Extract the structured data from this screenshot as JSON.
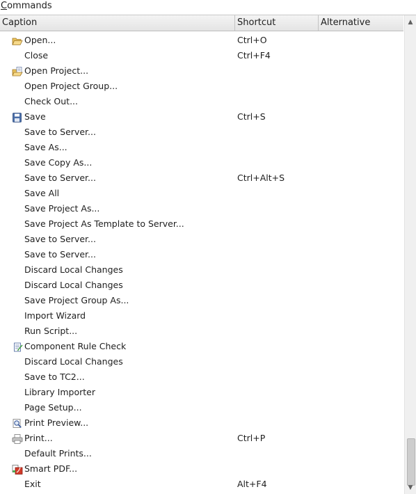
{
  "panel": {
    "title_first": "C",
    "title_rest": "ommands"
  },
  "columns": {
    "caption": "Caption",
    "shortcut": "Shortcut",
    "alternative": "Alternative"
  },
  "rows": [
    {
      "caption": "Open...",
      "shortcut": "Ctrl+O",
      "alt": "",
      "icon": "folder-open-icon"
    },
    {
      "caption": "Close",
      "shortcut": "Ctrl+F4",
      "alt": "",
      "icon": ""
    },
    {
      "caption": "Open Project...",
      "shortcut": "",
      "alt": "",
      "icon": "open-project-icon"
    },
    {
      "caption": "Open Project Group...",
      "shortcut": "",
      "alt": "",
      "icon": ""
    },
    {
      "caption": "Check Out...",
      "shortcut": "",
      "alt": "",
      "icon": ""
    },
    {
      "caption": "Save",
      "shortcut": "Ctrl+S",
      "alt": "",
      "icon": "save-disk-icon"
    },
    {
      "caption": "Save to Server...",
      "shortcut": "",
      "alt": "",
      "icon": ""
    },
    {
      "caption": "Save As...",
      "shortcut": "",
      "alt": "",
      "icon": ""
    },
    {
      "caption": "Save Copy As...",
      "shortcut": "",
      "alt": "",
      "icon": ""
    },
    {
      "caption": "Save to Server...",
      "shortcut": "Ctrl+Alt+S",
      "alt": "",
      "icon": ""
    },
    {
      "caption": "Save All",
      "shortcut": "",
      "alt": "",
      "icon": ""
    },
    {
      "caption": "Save Project As...",
      "shortcut": "",
      "alt": "",
      "icon": ""
    },
    {
      "caption": "Save Project As Template to Server...",
      "shortcut": "",
      "alt": "",
      "icon": ""
    },
    {
      "caption": "Save to Server...",
      "shortcut": "",
      "alt": "",
      "icon": ""
    },
    {
      "caption": "Save to Server...",
      "shortcut": "",
      "alt": "",
      "icon": ""
    },
    {
      "caption": "Discard Local Changes",
      "shortcut": "",
      "alt": "",
      "icon": ""
    },
    {
      "caption": "Discard Local Changes",
      "shortcut": "",
      "alt": "",
      "icon": ""
    },
    {
      "caption": "Save Project Group As...",
      "shortcut": "",
      "alt": "",
      "icon": ""
    },
    {
      "caption": "Import Wizard",
      "shortcut": "",
      "alt": "",
      "icon": ""
    },
    {
      "caption": "Run Script...",
      "shortcut": "",
      "alt": "",
      "icon": ""
    },
    {
      "caption": "Component Rule Check",
      "shortcut": "",
      "alt": "",
      "icon": "rule-check-icon"
    },
    {
      "caption": "Discard Local Changes",
      "shortcut": "",
      "alt": "",
      "icon": ""
    },
    {
      "caption": "Save to TC2...",
      "shortcut": "",
      "alt": "",
      "icon": ""
    },
    {
      "caption": "Library Importer",
      "shortcut": "",
      "alt": "",
      "icon": ""
    },
    {
      "caption": "Page Setup...",
      "shortcut": "",
      "alt": "",
      "icon": ""
    },
    {
      "caption": "Print Preview...",
      "shortcut": "",
      "alt": "",
      "icon": "print-preview-icon"
    },
    {
      "caption": "Print...",
      "shortcut": "Ctrl+P",
      "alt": "",
      "icon": "printer-icon"
    },
    {
      "caption": "Default Prints...",
      "shortcut": "",
      "alt": "",
      "icon": ""
    },
    {
      "caption": "Smart PDF...",
      "shortcut": "",
      "alt": "",
      "icon": "smart-pdf-icon"
    },
    {
      "caption": "Exit",
      "shortcut": "Alt+F4",
      "alt": "",
      "icon": ""
    }
  ],
  "scrollbar": {
    "up_icon": "scroll-up-arrow-icon",
    "down_icon": "scroll-down-arrow-icon",
    "position": 0.92
  }
}
